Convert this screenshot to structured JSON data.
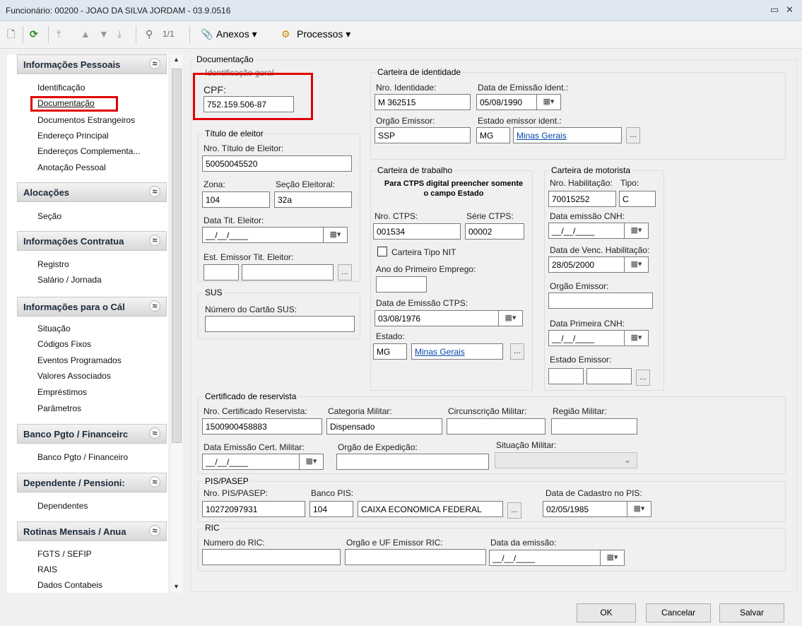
{
  "window": {
    "title": "Funcionário: 00200 - JOAO DA SILVA JORDAM - 03.9.0516"
  },
  "toolbar": {
    "page_indicator": "1/1",
    "anexos_label": "Anexos",
    "processos_label": "Processos"
  },
  "sidebar": {
    "sections": [
      {
        "title": "Informações Pessoais",
        "items": [
          "Identificação",
          "Documentação",
          "Documentos Estrangeiros",
          "Endereço Principal",
          "Endereços Complementa...",
          "Anotação Pessoal"
        ]
      },
      {
        "title": "Alocações",
        "items": [
          "Seção"
        ]
      },
      {
        "title": "Informações Contratua",
        "items": [
          "Registro",
          "Salário / Jornada"
        ]
      },
      {
        "title": "Informações para o Cál",
        "items": [
          "Situação",
          "Códigos Fixos",
          "Eventos Programados",
          "Valores Associados",
          "Empréstimos",
          "Parâmetros"
        ]
      },
      {
        "title": "Banco Pgto / Financeirc",
        "items": [
          "Banco Pgto / Financeiro"
        ]
      },
      {
        "title": "Dependente / Pensioni:",
        "items": [
          "Dependentes"
        ]
      },
      {
        "title": "Rotinas Mensais / Anua",
        "items": [
          "FGTS / SEFIP",
          "RAIS",
          "Dados Contabeis"
        ]
      }
    ]
  },
  "doc": {
    "title": "Documentação",
    "ident": {
      "title": "Identificação geral",
      "cpf_label": "CPF:",
      "cpf_value": "752.159.506-87"
    },
    "eleitor": {
      "title": "Título de eleitor",
      "nro_label": "Nro. Título de Eleitor:",
      "nro_value": "50050045520",
      "zona_label": "Zona:",
      "zona_value": "104",
      "secao_label": "Seção Eleitoral:",
      "secao_value": "32a",
      "data_label": "Data Tit. Eleitor:",
      "data_value": "__/__/____",
      "est_label": "Est. Emissor Tit. Eleitor:"
    },
    "sus": {
      "title": "SUS",
      "label": "Número do Cartão SUS:"
    },
    "ci": {
      "title": "Carteira de identidade",
      "nro_label": "Nro. Identidade:",
      "nro_value": "M 362515",
      "data_label": "Data de Emissão Ident.:",
      "data_value": "05/08/1990",
      "orgao_label": "Orgão Emissor:",
      "orgao_value": "SSP",
      "estado_label": "Estado emissor ident.:",
      "estado_uf": "MG",
      "estado_nome": "Minas Gerais"
    },
    "ctps": {
      "title": "Carteira de trabalho",
      "note": "Para CTPS digital preencher somente o campo Estado",
      "nro_label": "Nro. CTPS:",
      "nro_value": "001534",
      "serie_label": "Série CTPS:",
      "serie_value": "00002",
      "nit_label": "Carteira Tipo NIT",
      "ano_label": "Ano do Primeiro Emprego:",
      "data_label": "Data de Emissão CTPS:",
      "data_value": "03/08/1976",
      "estado_label": "Estado:",
      "estado_uf": "MG",
      "estado_nome": "Minas Gerais"
    },
    "cnh": {
      "title": "Carteira de motorista",
      "nro_label": "Nro. Habilitação:",
      "nro_value": "70015252",
      "tipo_label": "Tipo:",
      "tipo_value": "C",
      "emissao_label": "Data emissão CNH:",
      "emissao_value": "__/__/____",
      "venc_label": "Data de Venc. Habilitação:",
      "venc_value": "28/05/2000",
      "orgao_label": "Orgão Emissor:",
      "primeira_label": "Data Primeira CNH:",
      "primeira_value": "__/__/____",
      "estado_label": "Estado Emissor:"
    },
    "reserv": {
      "title": "Certificado de reservista",
      "nro_label": "Nro. Certificado Reservista:",
      "nro_value": "1500900458883",
      "cat_label": "Categoria Militar:",
      "cat_value": "Dispensado",
      "circ_label": "Circunscrição Militar:",
      "regiao_label": "Região Militar:",
      "data_label": "Data Emissão Cert. Militar:",
      "data_value": "__/__/____",
      "orgao_label": "Orgão de Expedição:",
      "sit_label": "Situação Militar:"
    },
    "pis": {
      "title": "PIS/PASEP",
      "nro_label": "Nro. PIS/PASEP:",
      "nro_value": "10272097931",
      "banco_label": "Banco PIS:",
      "banco_code": "104",
      "banco_nome": "CAIXA ECONOMICA FEDERAL",
      "data_label": "Data de Cadastro no PIS:",
      "data_value": "02/05/1985"
    },
    "ric": {
      "title": "RIC",
      "nro_label": "Numero do RIC:",
      "orgao_label": "Orgão e UF Emissor RIC:",
      "data_label": "Data da emissão:",
      "data_value": "__/__/____"
    }
  },
  "footer": {
    "ok": "OK",
    "cancel": "Cancelar",
    "save": "Salvar"
  },
  "colors": {
    "highlight": "#e00000",
    "link": "#0645ad"
  }
}
